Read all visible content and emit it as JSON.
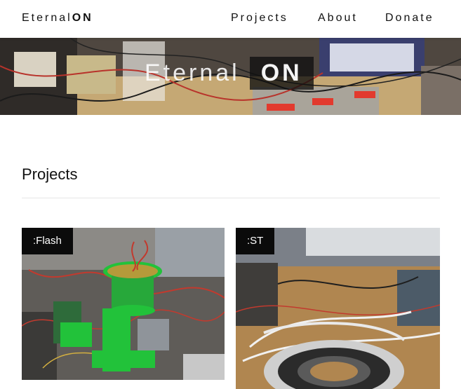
{
  "header": {
    "logo_light": "Eternal",
    "logo_bold": "ON",
    "nav": [
      "Projects",
      "About",
      "Donate"
    ]
  },
  "hero": {
    "title_light": "Eternal",
    "title_bold": "ON"
  },
  "projects": {
    "heading": "Projects",
    "cards": [
      {
        "label": ":Flash"
      },
      {
        "label": ":ST"
      }
    ]
  },
  "colors": {
    "accent_green": "#22c23a",
    "tag_background": "#0b0b0b"
  },
  "icons": [
    "electronics-lab-photo",
    "flash-project-photo",
    "st-project-photo"
  ]
}
